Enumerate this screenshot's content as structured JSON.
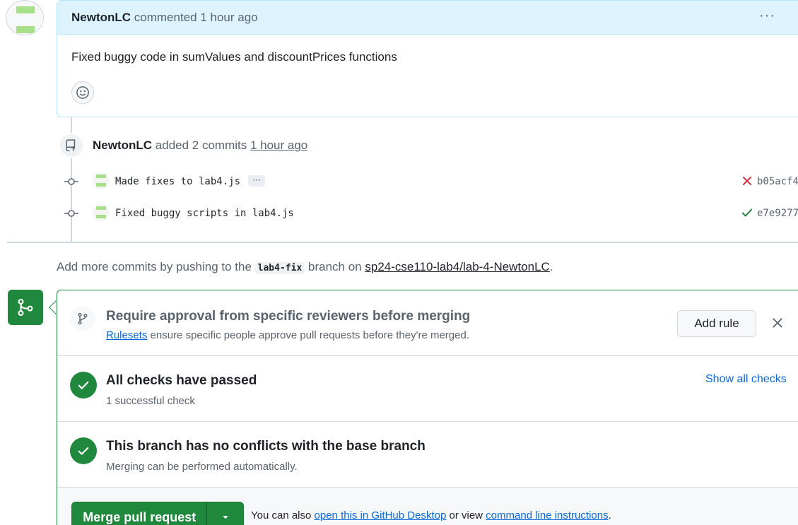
{
  "comment": {
    "author": "NewtonLC",
    "action": "commented",
    "time": "1 hour ago",
    "body": "Fixed buggy code in sumValues and discountPrices functions",
    "menu_label": "···"
  },
  "push_event": {
    "author": "NewtonLC",
    "action": "added 2 commits",
    "time": "1 hour ago"
  },
  "commits": [
    {
      "message": "Made fixes to lab4.js",
      "has_more": true,
      "more_label": "···",
      "status": "failure",
      "sha": "b05acf4"
    },
    {
      "message": "Fixed buggy scripts in lab4.js",
      "has_more": false,
      "status": "success",
      "sha": "e7e9277"
    }
  ],
  "hint": {
    "prefix": "Add more commits by pushing to the",
    "branch": "lab4-fix",
    "middle": "branch on",
    "repo": "sp24-cse110-lab4/lab-4-NewtonLC",
    "suffix": "."
  },
  "rules": {
    "title": "Require approval from specific reviewers before merging",
    "link": "Rulesets",
    "description": "ensure specific people approve pull requests before they're merged.",
    "add_button": "Add rule"
  },
  "checks": {
    "title": "All checks have passed",
    "subtitle": "1 successful check",
    "link": "Show all checks"
  },
  "conflicts": {
    "title": "This branch has no conflicts with the base branch",
    "subtitle": "Merging can be performed automatically."
  },
  "merge": {
    "button": "Merge pull request",
    "alt_prefix": "You can also",
    "alt_link1": "open this in GitHub Desktop",
    "alt_middle": "or view",
    "alt_link2": "command line instructions",
    "alt_suffix": "."
  },
  "colors": {
    "success": "#1f883d",
    "failure": "#cf222e",
    "link": "#0969da",
    "comment_header": "#ddf4ff"
  },
  "icons": {
    "comment_avatar": "identicon-green",
    "smiley": "smiley-icon",
    "push": "repo-push-icon",
    "commit_node": "git-commit-icon",
    "fail": "x-icon",
    "pass": "check-icon",
    "merge_badge": "git-merge-icon",
    "rule": "git-branch-icon",
    "close": "close-icon",
    "dropdown": "triangle-down-icon"
  }
}
